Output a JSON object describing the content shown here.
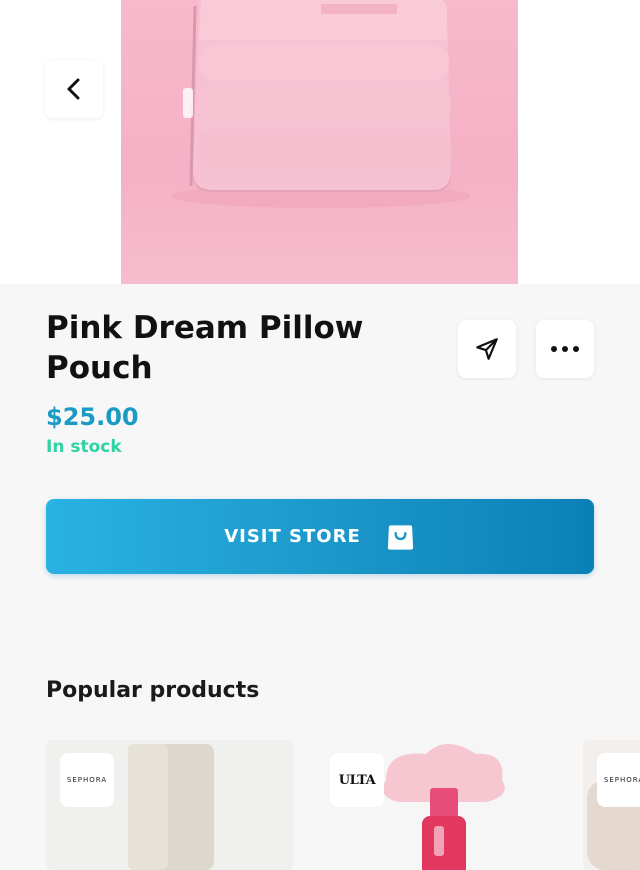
{
  "product": {
    "title": "Pink Dream Pillow Pouch",
    "price": "$25.00",
    "stock_status": "In stock"
  },
  "actions": {
    "visit_store_label": "VISIT STORE"
  },
  "popular": {
    "heading": "Popular products",
    "items": [
      {
        "brand": "SEPHORA"
      },
      {
        "brand": "ULTA"
      },
      {
        "brand": "SEPHORA"
      }
    ]
  },
  "colors": {
    "price": "#1a9bc4",
    "stock": "#2fd3a3",
    "button_start": "#29b3e2",
    "button_end": "#0a80b6"
  },
  "icons": {
    "back": "chevron-left-icon",
    "share": "send-icon",
    "more": "more-horizontal-icon",
    "visit_store": "shopping-bag-icon"
  }
}
